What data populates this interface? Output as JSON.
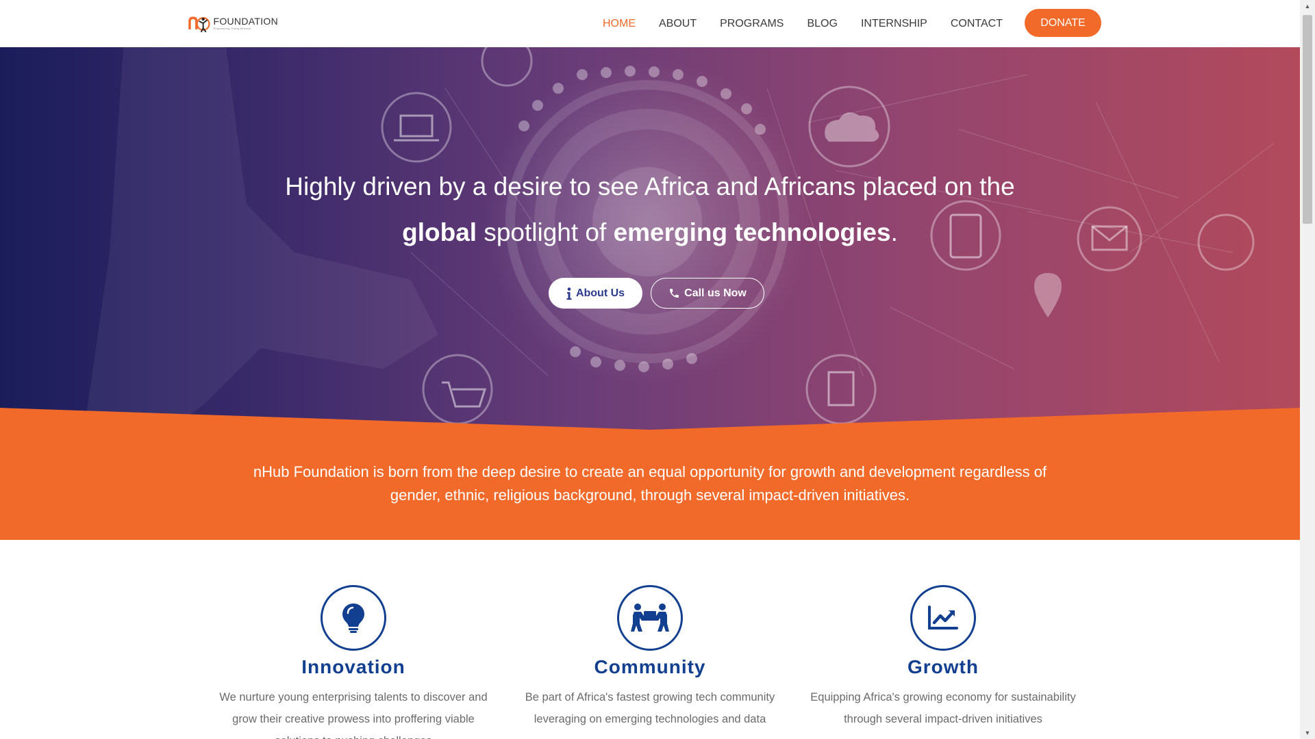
{
  "brand": {
    "logo_word": "FOUNDATION",
    "tagline": "Empowering Young Africans",
    "colors": {
      "orange": "#f26a2a",
      "navy": "#123f8f"
    }
  },
  "nav": {
    "items": [
      {
        "label": "HOME",
        "active": true
      },
      {
        "label": "ABOUT"
      },
      {
        "label": "PROGRAMS"
      },
      {
        "label": "BLOG"
      },
      {
        "label": "INTERNSHIP"
      },
      {
        "label": "CONTACT"
      }
    ],
    "donate": "DONATE"
  },
  "hero": {
    "line1": "Highly driven by a desire to see Africa and Africans  placed on the",
    "line2_bold1": "global",
    "line2_mid": " spotlight of ",
    "line2_bold2": "emerging technologies",
    "line2_end": ".",
    "btn_about": "About Us",
    "btn_call": "Call us Now",
    "btn_about_icon": "info-icon",
    "btn_call_icon": "phone-icon"
  },
  "band": {
    "text": "nHub Foundation is born from the deep desire to create an equal opportunity for growth and development regardless of gender, ethnic, religious background, through several impact-driven initiatives."
  },
  "features": [
    {
      "icon": "lightbulb-icon",
      "title": "Innovation",
      "desc": "We nurture young enterprising talents to discover and grow their creative prowess into proffering viable solutions to pushing challenges"
    },
    {
      "icon": "people-carry-icon",
      "title": "Community",
      "desc": "Be part of Africa's fastest growing tech community leveraging on emerging technologies and data"
    },
    {
      "icon": "chart-line-icon",
      "title": "Growth",
      "desc": "Equipping Africa's growing economy for sustainability through several impact-driven initiatives"
    }
  ]
}
